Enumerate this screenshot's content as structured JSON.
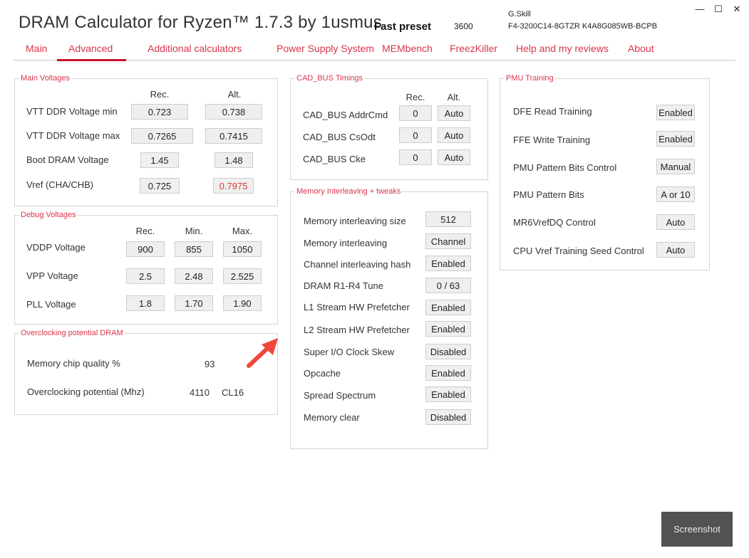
{
  "header": {
    "title": "DRAM Calculator for Ryzen™ 1.7.3 by 1usmus",
    "preset_label": "Fast preset",
    "preset_value": "3600",
    "memory_brand": "G.Skill",
    "memory_part": "F4-3200C14-8GTZR  K4A8G085WB-BCPB",
    "window_buttons": {
      "minimize": "—",
      "maximize": "☐",
      "close": "✕"
    }
  },
  "nav": {
    "tabs": [
      "Main",
      "Advanced",
      "Additional calculators",
      "Power Supply System",
      "MEMbench",
      "FreezKiller",
      "Help and my reviews",
      "About"
    ],
    "active": "Advanced",
    "accent_color": "#c8102e"
  },
  "main_voltages": {
    "title": "Main Voltages",
    "col_rec": "Rec.",
    "col_alt": "Alt.",
    "rows": [
      {
        "label": "VTT DDR Voltage min",
        "rec": "0.723",
        "alt": "0.738"
      },
      {
        "label": "VTT DDR Voltage max",
        "rec": "0.7265",
        "alt": "0.7415"
      },
      {
        "label": "Boot DRAM Voltage",
        "rec": "1.45",
        "alt": "1.48"
      },
      {
        "label": "Vref (CHA/CHB)",
        "rec": "0.725",
        "alt": "0.7975"
      }
    ]
  },
  "debug_voltages": {
    "title": "Debug Voltages",
    "col_rec": "Rec.",
    "col_min": "Min.",
    "col_max": "Max.",
    "rows": [
      {
        "label": "VDDP Voltage",
        "rec": "900",
        "min": "855",
        "max": "1050"
      },
      {
        "label": "VPP Voltage",
        "rec": "2.5",
        "min": "2.48",
        "max": "2.525"
      },
      {
        "label": "PLL Voltage",
        "rec": "1.8",
        "min": "1.70",
        "max": "1.90"
      }
    ]
  },
  "oc_potential": {
    "title": "Overclocking potential DRAM",
    "quality_label": "Memory chip quality %",
    "quality_value": "93",
    "potential_label": "Overclocking potential (Mhz)",
    "potential_value": "4110",
    "potential_cl": "CL16"
  },
  "cad_bus": {
    "title": "CAD_BUS Timings",
    "col_rec": "Rec.",
    "col_alt": "Alt.",
    "rows": [
      {
        "label": "CAD_BUS AddrCmd",
        "rec": "0",
        "alt": "Auto"
      },
      {
        "label": "CAD_BUS CsOdt",
        "rec": "0",
        "alt": "Auto"
      },
      {
        "label": "CAD_BUS Cke",
        "rec": "0",
        "alt": "Auto"
      }
    ]
  },
  "interleaving": {
    "title": "Memory Interleaving + tweaks",
    "rows": [
      {
        "label": "Memory interleaving size",
        "value": "512"
      },
      {
        "label": "Memory interleaving",
        "value": "Channel"
      },
      {
        "label": "Channel interleaving hash",
        "value": "Enabled"
      },
      {
        "label": "DRAM R1-R4 Tune",
        "value": "0 / 63"
      },
      {
        "label": "L1 Stream HW Prefetcher",
        "value": "Enabled"
      },
      {
        "label": "L2 Stream HW Prefetcher",
        "value": "Enabled"
      },
      {
        "label": "Super I/O Clock Skew",
        "value": "Disabled"
      },
      {
        "label": "Opcache",
        "value": "Enabled"
      },
      {
        "label": "Spread Spectrum",
        "value": "Enabled"
      },
      {
        "label": "Memory clear",
        "value": "Disabled"
      }
    ]
  },
  "pmu": {
    "title": "PMU Training",
    "rows": [
      {
        "label": "DFE Read Training",
        "value": "Enabled"
      },
      {
        "label": "FFE Write Training",
        "value": "Enabled"
      },
      {
        "label": "PMU Pattern Bits Control",
        "value": "Manual"
      },
      {
        "label": "PMU Pattern Bits",
        "value": "A or 10"
      },
      {
        "label": "MR6VrefDQ Control",
        "value": "Auto"
      },
      {
        "label": "CPU Vref Training Seed Control",
        "value": "Auto"
      }
    ]
  },
  "footer": {
    "screenshot_label": "Screenshot"
  },
  "colors": {
    "accent": "#c8102e",
    "warning_value": "#e53935",
    "arrow": "#f0463c"
  }
}
